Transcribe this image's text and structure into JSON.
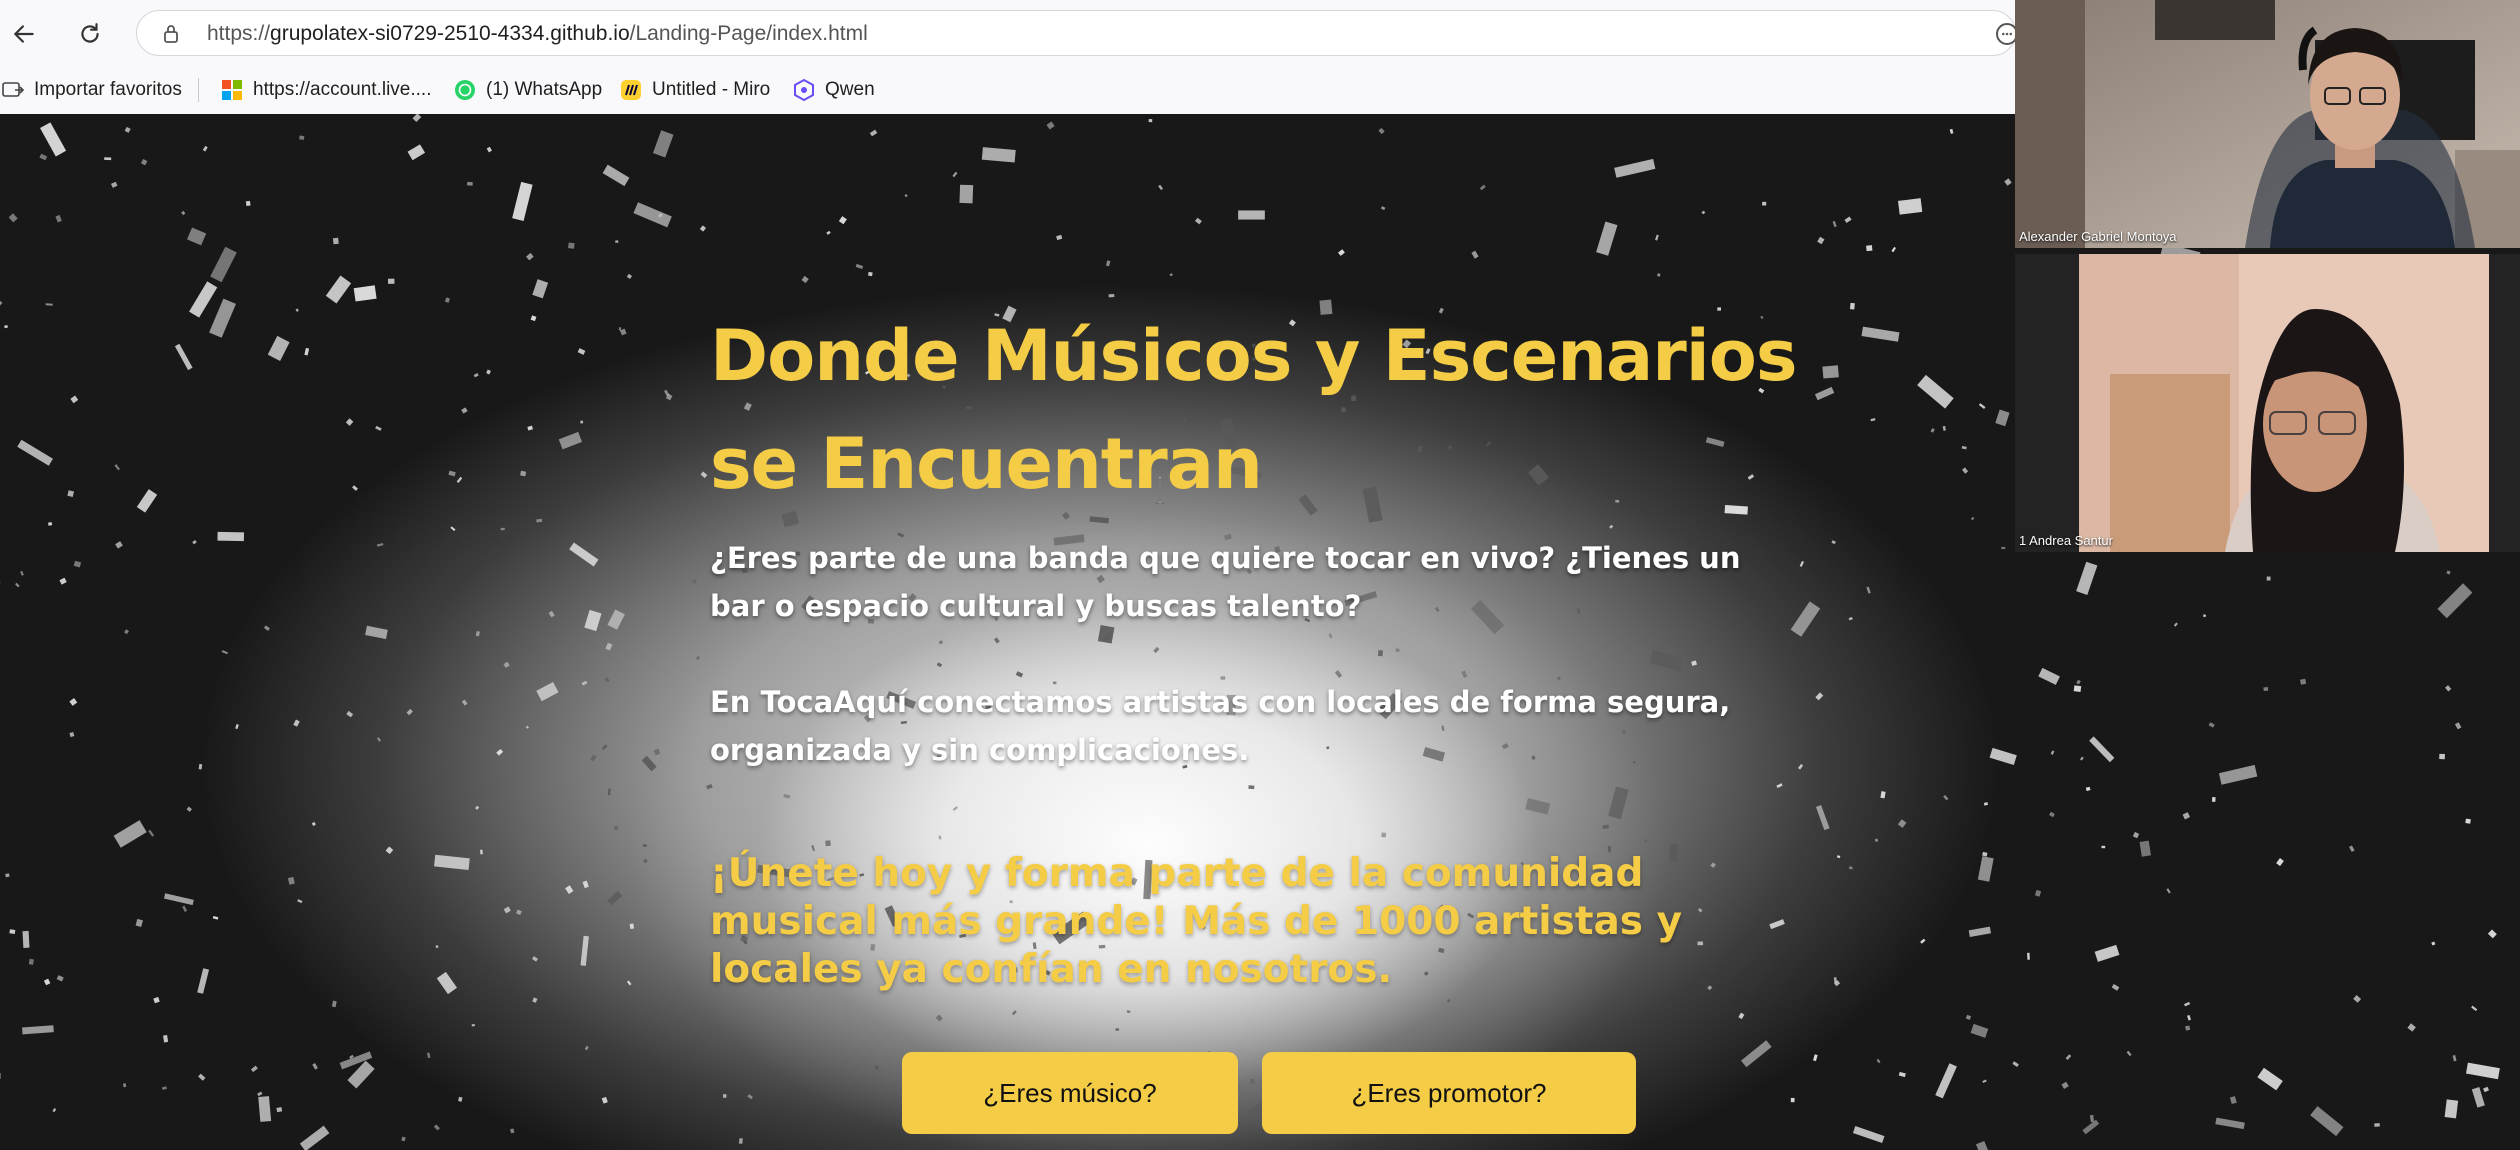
{
  "browser": {
    "url_prefix": "https://",
    "url_host": "grupolatex-si0729-2510-4334.github.io",
    "url_path": "/Landing-Page/index.html",
    "bookmarks": [
      {
        "label": "Importar favoritos",
        "icon": "import-icon"
      },
      {
        "label": "https://account.live....",
        "icon": "microsoft-icon"
      },
      {
        "label": "(1) WhatsApp",
        "icon": "whatsapp-icon"
      },
      {
        "label": "Untitled - Miro",
        "icon": "miro-icon"
      },
      {
        "label": "Qwen",
        "icon": "qwen-icon"
      }
    ]
  },
  "hero": {
    "headline": "Donde Músicos y Escenarios se Encuentran",
    "lead": "¿Eres parte de una banda que quiere tocar en vivo? ¿Tienes un bar o espacio cultural y buscas talento?",
    "connect_prefix": "En ",
    "brand": "TocaAquí",
    "connect_suffix": " conectamos artistas con locales de forma segura, organizada y sin complicaciones.",
    "cta": "¡Únete hoy y forma parte de la comunidad musical más grande! Más de 1000 artistas y locales ya confían en nosotros.",
    "buttons": {
      "musico": "¿Eres músico?",
      "promotor": "¿Eres promotor?"
    }
  },
  "video_call": {
    "participants": [
      {
        "name": "Alexander Gabriel Montoya"
      },
      {
        "name": "1 Andrea Santur"
      }
    ]
  },
  "colors": {
    "accent": "#f4cc45",
    "hero_dark": "#121212",
    "button_text": "#111111"
  }
}
